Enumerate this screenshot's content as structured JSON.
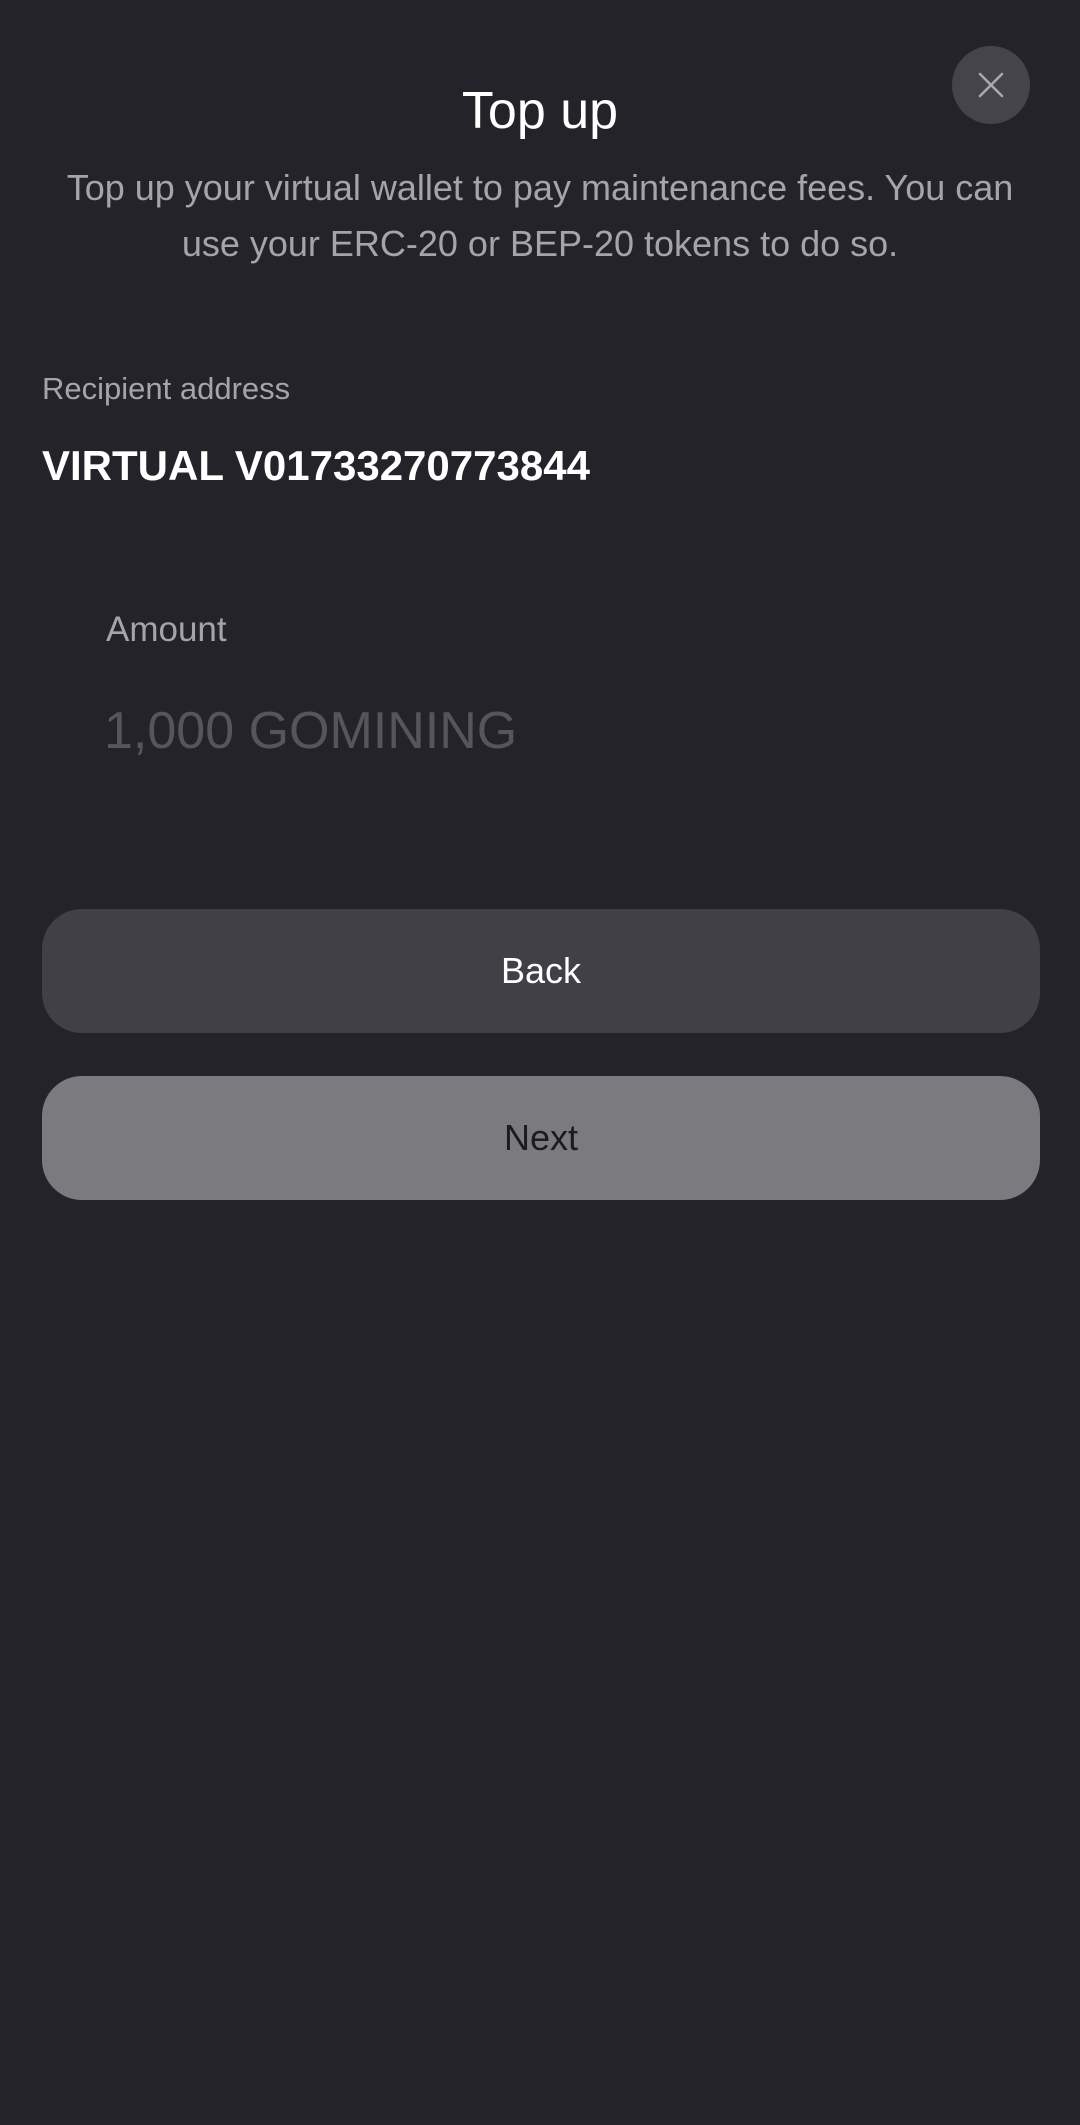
{
  "modal": {
    "title": "Top up",
    "subtitle": "Top up your virtual wallet to pay maintenance fees. You can use your ERC-20 or BEP-20 tokens to do so.",
    "close_icon": "close-icon"
  },
  "recipient": {
    "label": "Recipient address",
    "value": "VIRTUAL V01733270773844"
  },
  "amount": {
    "label": "Amount",
    "placeholder": "1,000 GOMINING",
    "value": ""
  },
  "buttons": {
    "back_label": "Back",
    "next_label": "Next"
  },
  "colors": {
    "background": "#242329",
    "close_button_bg": "#45444b",
    "secondary_text": "#a5a4aa",
    "placeholder_text": "#56555c",
    "back_button_bg": "#414046",
    "next_button_bg": "#7b7b7f"
  }
}
